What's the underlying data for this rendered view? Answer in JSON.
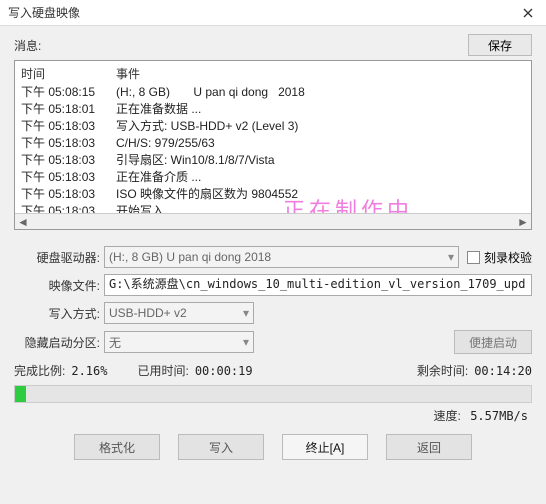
{
  "title": "写入硬盘映像",
  "msg_label": "消息:",
  "save_label": "保存",
  "log": {
    "header_time": "时间",
    "header_event": "事件",
    "rows": [
      {
        "time": "下午 05:08:15",
        "event": "(H:, 8 GB)       U pan qi dong   2018"
      },
      {
        "time": "下午 05:18:01",
        "event": "正在准备数据 ..."
      },
      {
        "time": "下午 05:18:03",
        "event": "写入方式: USB-HDD+ v2 (Level 3)"
      },
      {
        "time": "下午 05:18:03",
        "event": "C/H/S: 979/255/63"
      },
      {
        "time": "下午 05:18:03",
        "event": "引导扇区: Win10/8.1/8/7/Vista"
      },
      {
        "time": "下午 05:18:03",
        "event": "正在准备介质 ..."
      },
      {
        "time": "下午 05:18:03",
        "event": "ISO 映像文件的扇区数为 9804552"
      },
      {
        "time": "下午 05:18:03",
        "event": "开始写入 ..."
      }
    ],
    "overlay": "正在制作中...."
  },
  "form": {
    "drive_label": "硬盘驱动器:",
    "drive_value": "(H:, 8 GB)       U pan qi dong   2018",
    "verify_label": "刻录校验",
    "image_label": "映像文件:",
    "image_value": "G:\\系统源盘\\cn_windows_10_multi-edition_vl_version_1709_upd",
    "write_mode_label": "写入方式:",
    "write_mode_value": "USB-HDD+ v2",
    "hidden_part_label": "隐藏启动分区:",
    "hidden_part_value": "无",
    "easy_boot_label": "便捷启动"
  },
  "stats": {
    "percent_label": "完成比例:",
    "percent_value": "2.16%",
    "elapsed_label": "已用时间:",
    "elapsed_value": "00:00:19",
    "remain_label": "剩余时间:",
    "remain_value": "00:14:20",
    "speed_label": "速度:",
    "speed_value": "5.57MB/s"
  },
  "buttons": {
    "format": "格式化",
    "write": "写入",
    "abort": "终止[A]",
    "back": "返回"
  }
}
